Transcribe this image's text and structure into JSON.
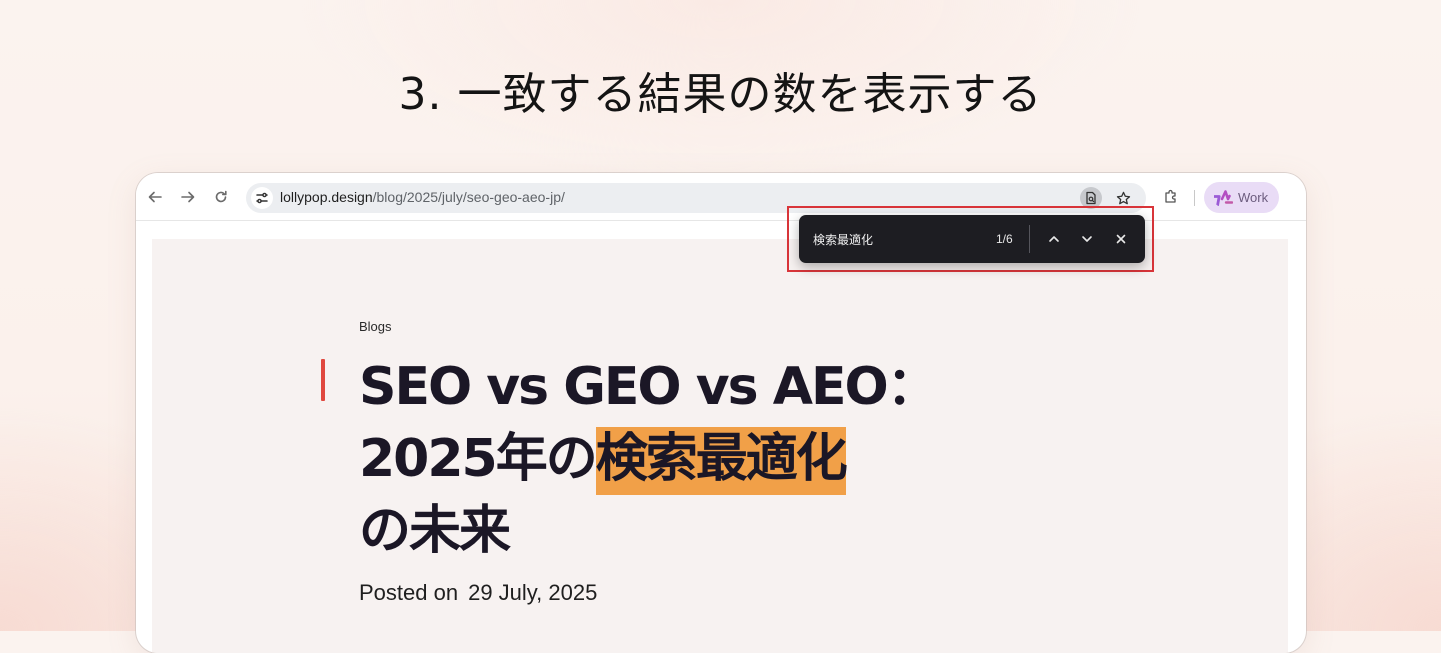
{
  "headline": "3. 一致する結果の数を表示する",
  "browser": {
    "url_domain": "lollypop.design",
    "url_path": "/blog/2025/july/seo-geo-aeo-jp/",
    "profile_label": "Work"
  },
  "find_bar": {
    "query": "検索最適化",
    "match_count": "1/6"
  },
  "article": {
    "eyebrow": "Blogs",
    "title_line1": "SEO vs GEO vs AEO：",
    "title_line2_prefix": "2025年の",
    "title_line2_highlight": "検索最適化",
    "title_line3": "の未来",
    "posted_label": "Posted on",
    "posted_date": "29 July, 2025"
  },
  "colors": {
    "find_match_highlight": "#f1a048",
    "accent_bar": "#e0483f",
    "callout_frame": "#d9353a",
    "find_bar_background": "#1d1d22"
  }
}
